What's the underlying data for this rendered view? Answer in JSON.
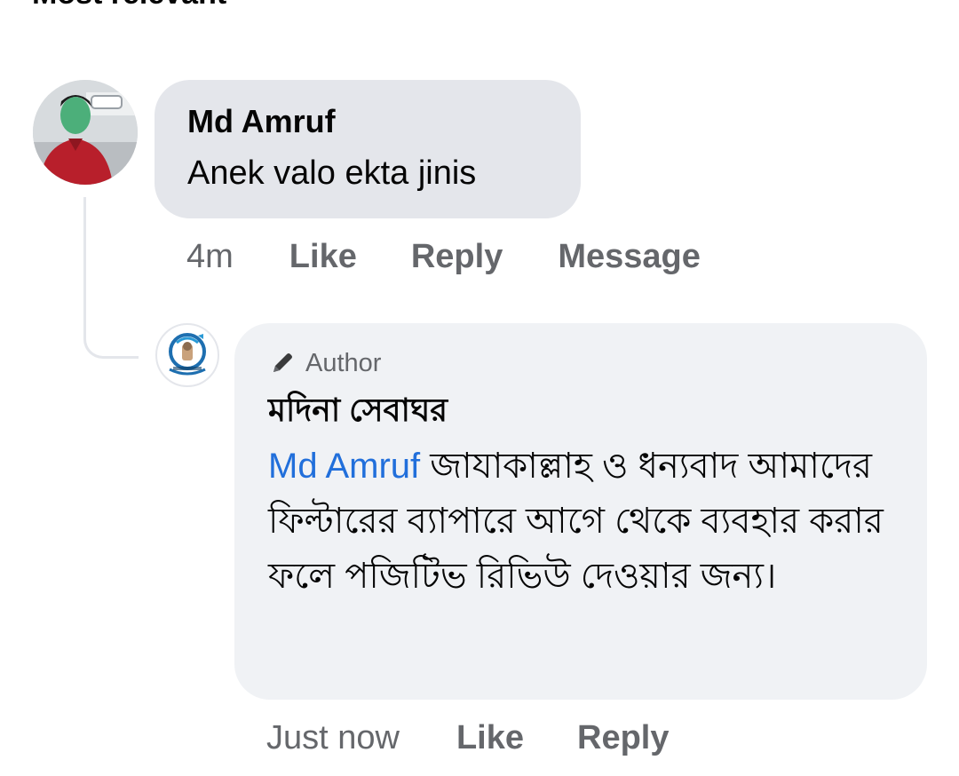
{
  "header": {
    "sort_label": "Most relevant"
  },
  "comment": {
    "author": "Md Amruf",
    "text": "Anek valo ekta jinis",
    "time": "4m",
    "actions": {
      "like": "Like",
      "reply": "Reply",
      "message": "Message"
    }
  },
  "reply": {
    "badge": "Author",
    "author": "মদিনা সেবাঘর",
    "mention": "Md Amruf",
    "text": " জাযাকাল্লাহ ও ধন্যবাদ আমাদের ফিল্টারের ব্যাপারে আগে থেকে ব্যবহার করার ফলে পজিটিভ রিভিউ দেওয়ার জন্য।",
    "time": "Just now",
    "actions": {
      "like": "Like",
      "reply": "Reply"
    }
  },
  "colors": {
    "bubble_main": "#e4e6eb",
    "bubble_reply": "#f0f2f5",
    "secondary_text": "#65676b",
    "mention": "#216fdb",
    "thread_line": "#e4e6eb"
  },
  "icons": {
    "badge_icon": "pencil-icon",
    "page_avatar": "water-filter-logo",
    "user_avatar": "user-photo"
  }
}
